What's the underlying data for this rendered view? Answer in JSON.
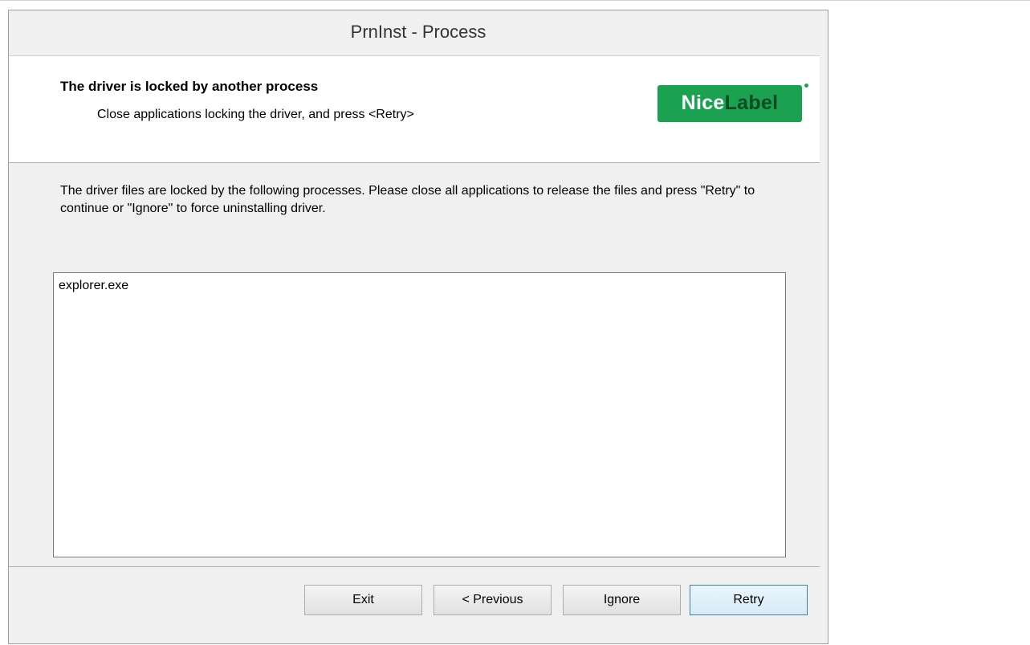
{
  "window": {
    "title": "PrnInst - Process"
  },
  "header": {
    "title": "The driver is locked by another process",
    "subtitle": "Close applications locking the driver, and press <Retry>",
    "logo": {
      "nice": "Nice",
      "label": "Label",
      "brand_color": "#1aa251"
    }
  },
  "body": {
    "description": "The driver files are locked by the following processes. Please close all applications to release the files and press \"Retry\" to continue or \"Ignore\" to force uninstalling driver.",
    "processes": [
      "explorer.exe"
    ]
  },
  "buttons": {
    "exit": "Exit",
    "previous": "< Previous",
    "ignore": "Ignore",
    "retry": "Retry"
  }
}
